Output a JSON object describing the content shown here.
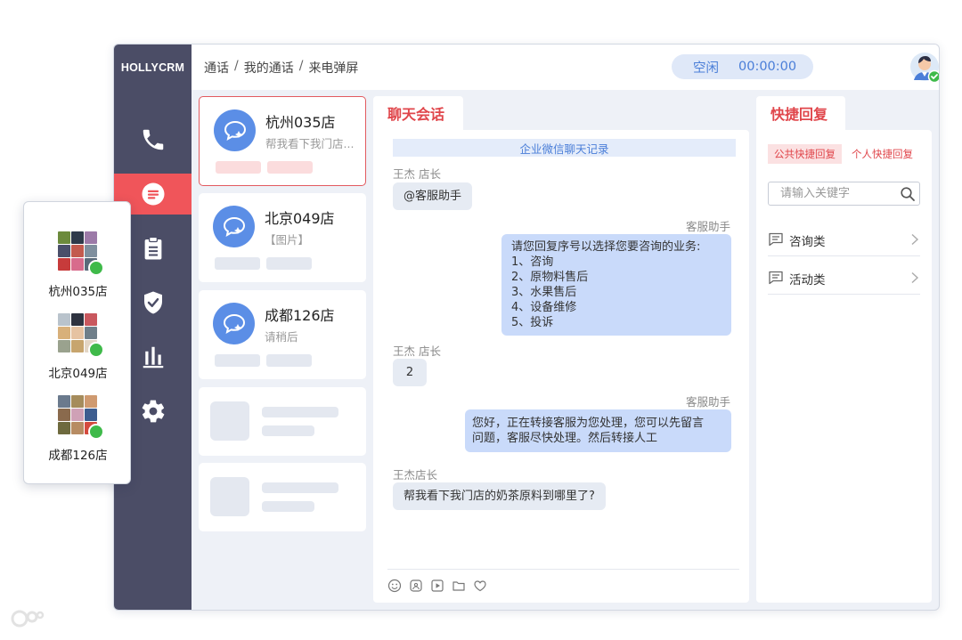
{
  "app": {
    "logo": "HOLLYCRM",
    "breadcrumb": [
      "通话",
      "我的通话",
      "来电弹屏"
    ],
    "breadcrumb_sep": "/",
    "status": "空闲",
    "timer": "00:00:00",
    "accent_color": "#f0555a",
    "sidebar_color": "#4b4d66"
  },
  "sidebar": {
    "items": [
      {
        "icon": "phone-icon"
      },
      {
        "icon": "chat-icon",
        "active": true
      },
      {
        "icon": "clipboard-icon"
      },
      {
        "icon": "shield-icon"
      },
      {
        "icon": "bar-chart-icon"
      },
      {
        "icon": "gear-icon"
      }
    ]
  },
  "sessions": [
    {
      "name": "杭州035店",
      "preview": "帮我看下我门店...",
      "selected": true
    },
    {
      "name": "北京049店",
      "preview": "【图片】"
    },
    {
      "name": "成都126店",
      "preview": "请稍后"
    }
  ],
  "chat": {
    "tab": "聊天会话",
    "banner": "企业微信聊天记录",
    "messages": [
      {
        "sender": "王杰 店长",
        "text": "@客服助手",
        "side": "left"
      },
      {
        "sender": "客服助手",
        "text": [
          "请您回复序号以选择您要咨询的业务:",
          "1、咨询",
          "2、原物料售后",
          "3、水果售后",
          "4、设备维修",
          "5、投诉"
        ],
        "side": "right"
      },
      {
        "sender": "王杰 店长",
        "text": "2",
        "side": "left"
      },
      {
        "sender": "客服助手",
        "text": [
          "您好，正在转接客服为您处理，您可以先留言",
          "问题，客服尽快处理。然后转接人工"
        ],
        "side": "right"
      },
      {
        "sender": "王杰店长",
        "text": "帮我看下我门店的奶茶原料到哪里了?",
        "side": "left"
      }
    ],
    "tools": [
      "emoji-icon",
      "image-icon",
      "video-icon",
      "folder-icon",
      "heart-icon"
    ]
  },
  "quick_reply": {
    "tab": "快捷回复",
    "subtabs": [
      "公共快捷回复",
      "个人快捷回复"
    ],
    "search_placeholder": "请输入关键字",
    "categories": [
      "咨询类",
      "活动类"
    ]
  },
  "groups": [
    {
      "name": "杭州035店"
    },
    {
      "name": "北京049店"
    },
    {
      "name": "成都126店"
    }
  ]
}
